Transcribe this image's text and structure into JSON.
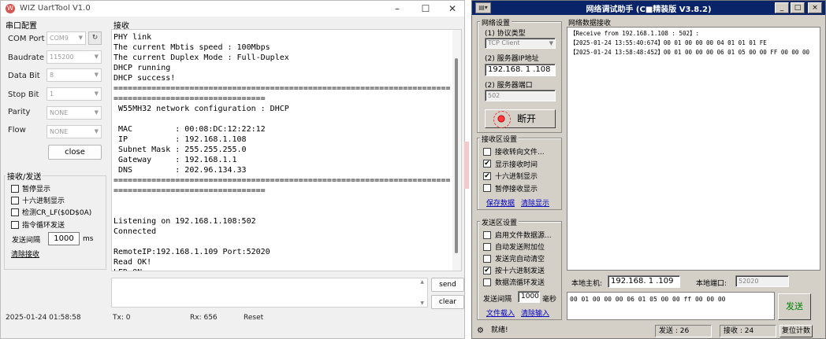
{
  "wiz": {
    "title": "WIZ UartTool V1.0",
    "serial_group": "串口配置",
    "recv_group_label": "接收",
    "config": [
      {
        "label": "COM Port",
        "value": "COM9"
      },
      {
        "label": "Baudrate",
        "value": "115200"
      },
      {
        "label": "Data Bit",
        "value": "8"
      },
      {
        "label": "Stop Bit",
        "value": "1"
      },
      {
        "label": "Parity",
        "value": "NONE"
      },
      {
        "label": "Flow",
        "value": "NONE"
      }
    ],
    "close_button": "close",
    "rxtx_group": "接收/发送",
    "options": [
      "暂停显示",
      "十六进制显示",
      "检测CR_LF($0D$0A)",
      "指令循环发送"
    ],
    "interval_label": "发送间隔",
    "interval_value": "1000",
    "interval_unit": "ms",
    "clear_recv_link": "清除接收",
    "terminal_lines": [
      "PHY link",
      "The current Mbtis speed : 100Mbps",
      "The current Duplex Mode : Full-Duplex",
      "DHCP running",
      "DHCP success!",
      "=======================================================================",
      "================================",
      " W55MH32 network configuration : DHCP",
      "",
      " MAC         : 00:08:DC:12:22:12",
      " IP          : 192.168.1.108",
      " Subnet Mask : 255.255.255.0",
      " Gateway     : 192.168.1.1",
      " DNS         : 202.96.134.33",
      "=======================================================================",
      "================================",
      "",
      "",
      "Listening on 192.168.1.108:502",
      "Connected",
      "",
      "RemoteIP:192.168.1.109 Port:52020",
      "Read OK!",
      "LED ON"
    ],
    "send_button": "send",
    "clear_button": "clear",
    "status": {
      "timestamp": "2025-01-24 01:58:58",
      "tx": "Tx: 0",
      "rx": "Rx: 656",
      "reset": "Reset"
    }
  },
  "net": {
    "title": "网络调试助手  (C■精装版 V3.8.2)",
    "net_settings_group": "网络设置",
    "protocol_label": "(1) 协议类型",
    "protocol_value": "TCP Client",
    "server_ip_label": "(2) 服务器IP地址",
    "server_ip_value": "192.168. 1 .108",
    "server_port_label": "(2) 服务器端口",
    "server_port_value": "502",
    "disconnect_button": "断开",
    "recv_settings_group": "接收区设置",
    "recv_options": [
      {
        "label": "接收转向文件...",
        "checked": false
      },
      {
        "label": "显示接收时间",
        "checked": true
      },
      {
        "label": "十六进制显示",
        "checked": true
      },
      {
        "label": "暂停接收显示",
        "checked": false
      }
    ],
    "save_data_link": "保存数据",
    "clear_display_link": "清除显示",
    "send_settings_group": "发送区设置",
    "send_options": [
      {
        "label": "启用文件数据源...",
        "checked": false
      },
      {
        "label": "自动发送附加位",
        "checked": false
      },
      {
        "label": "发送完自动清空",
        "checked": false
      },
      {
        "label": "按十六进制发送",
        "checked": true
      },
      {
        "label": "数据流循环发送",
        "checked": false
      }
    ],
    "send_interval_label": "发送间隔",
    "send_interval_value": "1000",
    "send_interval_unit": "毫秒",
    "file_load_link": "文件载入",
    "clear_input_link": "清除输入",
    "recv_data_group": "网络数据接收",
    "recv_lines": [
      "【Receive from 192.168.1.108 : 502】:",
      "【2025-01-24 13:55:40:674】00 01 00 00 00 04 01 01 01 FE",
      "【2025-01-24 13:58:48:452】00 01 00 00 00 06 01 05 00 00 FF 00 00 00"
    ],
    "local_host_label": "本地主机:",
    "local_host_value": "192.168. 1 .109",
    "local_port_label": "本地端口:",
    "local_port_value": "52020",
    "send_text": "00 01 00 00 00 06 01 05 00 00 ff 00 00 00",
    "send_button": "发送",
    "status_ready": "就绪!",
    "status_sent": "发送 : 26",
    "status_recv": "接收 : 24",
    "reset_count_button": "复位计数"
  }
}
